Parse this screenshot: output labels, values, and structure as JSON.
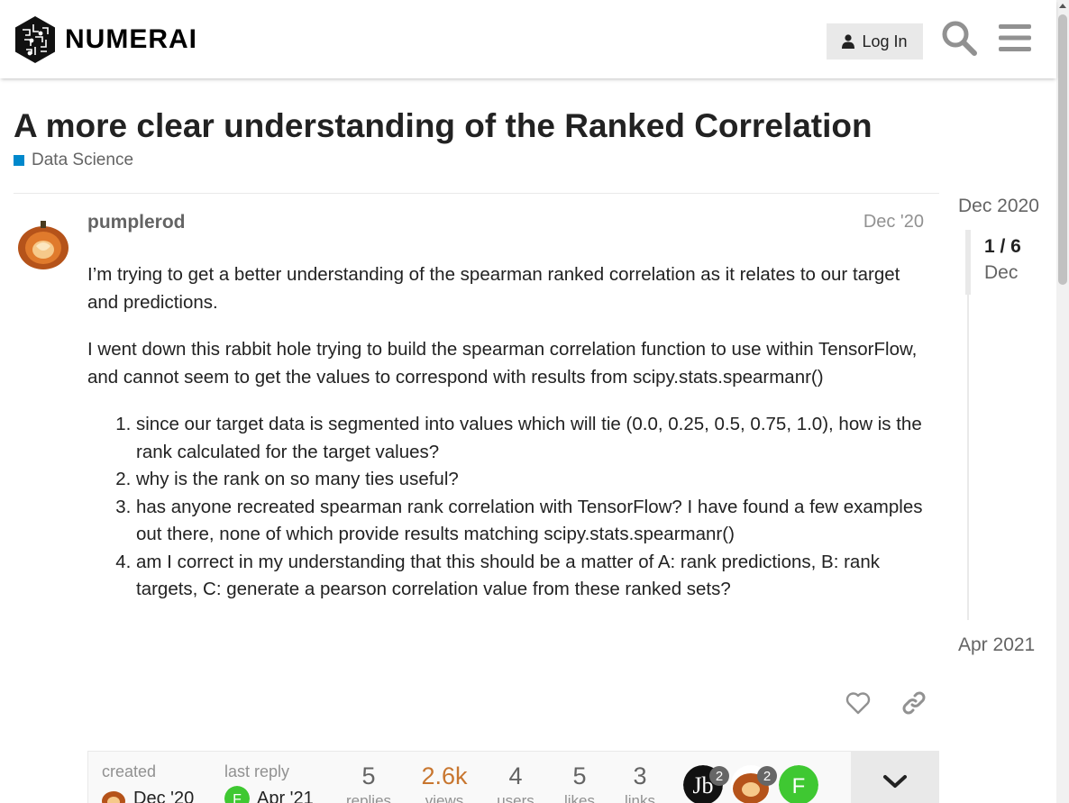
{
  "header": {
    "logo_text": "NUMERAI",
    "login_label": "Log In",
    "search_icon": "search-icon",
    "menu_icon": "hamburger-menu-icon"
  },
  "topic": {
    "title": "A more clear understanding of the Ranked Correlation",
    "category": "Data Science",
    "category_color": "#0088cc"
  },
  "post": {
    "username": "pumplerod",
    "date": "Dec '20",
    "paragraphs": [
      "I’m trying to get a better understanding of the spearman ranked correlation as it relates to our target and predictions.",
      "I went down this rabbit hole trying to build the spearman correlation function to use within TensorFlow, and cannot seem to get the values to correspond with results from scipy.stats.spearmanr()"
    ],
    "list": [
      "since our target data is segmented into values which will tie (0.0, 0.25, 0.5, 0.75, 1.0), how is the rank calculated for the target values?",
      "why is the rank on so many ties useful?",
      "has anyone recreated spearman rank correlation with TensorFlow? I have found a few examples out there, none of which provide results matching scipy.stats.spearmanr()",
      "am I correct in my understanding that this should be a matter of A: rank predictions, B: rank targets, C: generate a pearson correlation value from these ranked sets?"
    ]
  },
  "topic_map": {
    "created_label": "created",
    "created_date": "Dec '20",
    "last_reply_label": "last reply",
    "last_reply_date": "Apr '21",
    "stats": {
      "replies": {
        "num": "5",
        "label": "replies"
      },
      "views": {
        "num": "2.6k",
        "label": "views"
      },
      "users": {
        "num": "4",
        "label": "users"
      },
      "likes": {
        "num": "5",
        "label": "likes"
      },
      "links": {
        "num": "3",
        "label": "links"
      }
    },
    "participants": [
      {
        "count": "2",
        "letter": ""
      },
      {
        "count": "2",
        "letter": ""
      },
      {
        "count": "",
        "letter": "F"
      }
    ]
  },
  "timeline": {
    "start": "Dec 2020",
    "position": "1 / 6",
    "current_date": "Dec",
    "end": "Apr 2021"
  }
}
